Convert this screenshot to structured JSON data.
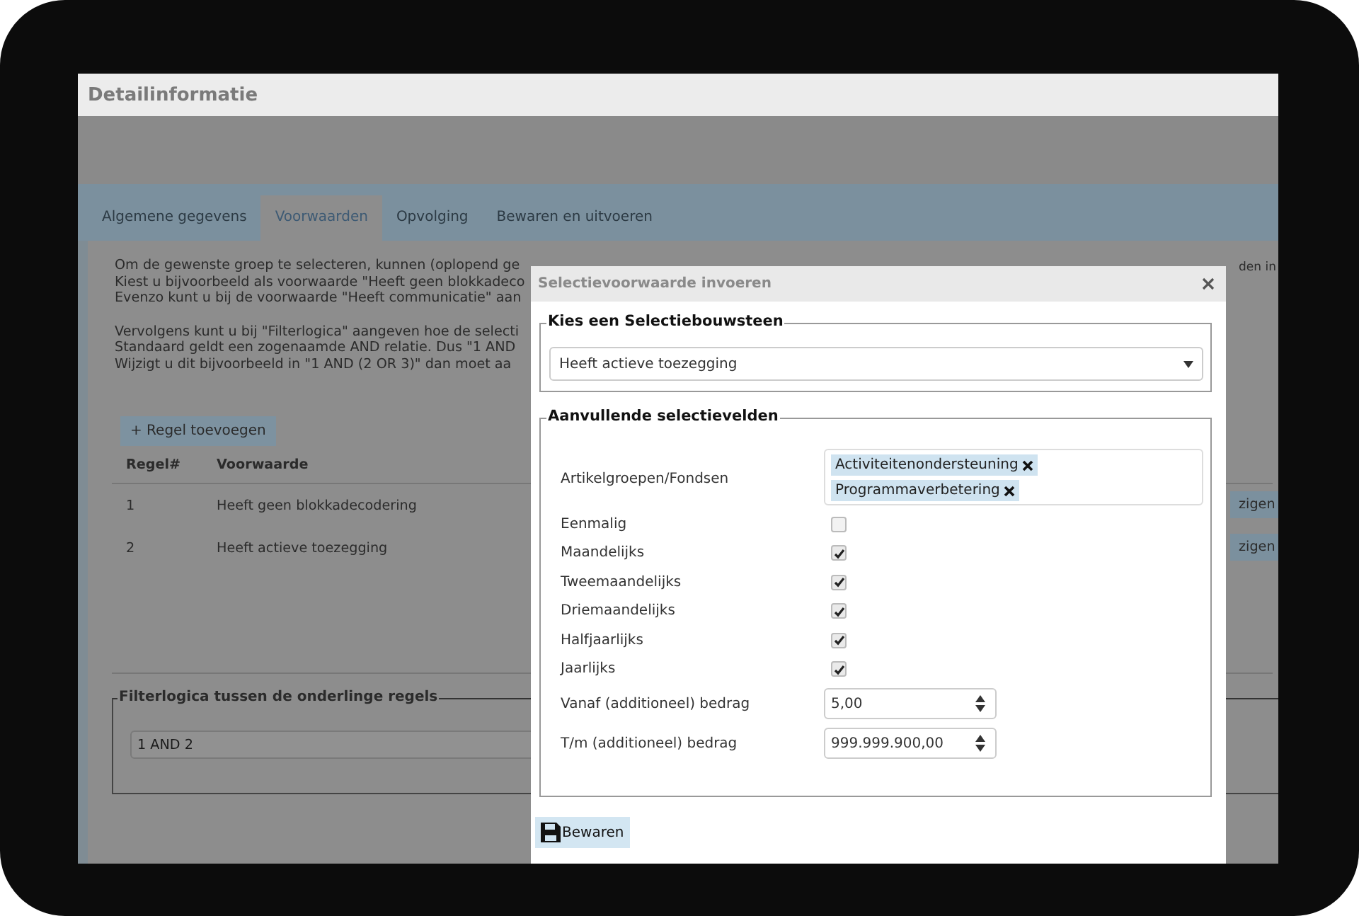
{
  "window": {
    "title": "Detailinformatie"
  },
  "tabs": [
    {
      "label": "Algemene gegevens",
      "selected": false
    },
    {
      "label": "Voorwaarden",
      "selected": true
    },
    {
      "label": "Opvolging",
      "selected": false
    },
    {
      "label": "Bewaren en uitvoeren",
      "selected": false
    }
  ],
  "intro_paragraphs": [
    [
      "Om de gewenste groep te selecteren, kunnen (oplopend ge",
      "Kiest u bijvoorbeeld als voorwaarde \"Heeft geen blokkadeco",
      "Evenzo kunt u bij de voorwaarde \"Heeft communicatie\" aan"
    ],
    [
      "Vervolgens kunt u bij \"Filterlogica\" aangeven hoe de selecti",
      "Standaard geldt een zogenaamde AND relatie. Dus \"1 AND",
      "Wijzigt u dit bijvoorbeeld in \"1 AND (2 OR 3)\" dan moet aa"
    ]
  ],
  "intro_right_fragment": "den in",
  "add_rule_button": "+ Regel toevoegen",
  "rules_table": {
    "columns": [
      "Regel#",
      "Voorwaarde"
    ],
    "rows": [
      {
        "cells": [
          "1",
          "Heeft geen blokkadecodering"
        ],
        "action": "zigen"
      },
      {
        "cells": [
          "2",
          "Heeft actieve toezegging"
        ],
        "action": "zigen"
      }
    ]
  },
  "filter_logic": {
    "legend": "Filterlogica tussen de onderlinge regels",
    "value": "1 AND 2"
  },
  "dialog": {
    "title": "Selectievoorwaarde invoeren",
    "building_block": {
      "legend": "Kies een Selectiebouwsteen",
      "value": "Heeft actieve toezegging"
    },
    "extra_fields": {
      "legend": "Aanvullende selectievelden",
      "fields": [
        {
          "kind": "tags",
          "label": "Artikelgroepen/Fondsen",
          "tags": [
            "Activiteitenondersteuning",
            "Programmaverbetering"
          ]
        },
        {
          "kind": "checkbox",
          "label": "Eenmalig",
          "checked": false
        },
        {
          "kind": "checkbox",
          "label": "Maandelijks",
          "checked": true
        },
        {
          "kind": "checkbox",
          "label": "Tweemaandelijks",
          "checked": true
        },
        {
          "kind": "checkbox",
          "label": "Driemaandelijks",
          "checked": true
        },
        {
          "kind": "checkbox",
          "label": "Halfjaarlijks",
          "checked": true
        },
        {
          "kind": "checkbox",
          "label": "Jaarlijks",
          "checked": true
        },
        {
          "kind": "number",
          "label": "Vanaf (additioneel) bedrag",
          "value": "5,00"
        },
        {
          "kind": "number",
          "label": "T/m (additioneel) bedrag",
          "value": "999.999.900,00"
        }
      ]
    },
    "save_button": "Bewaren"
  }
}
